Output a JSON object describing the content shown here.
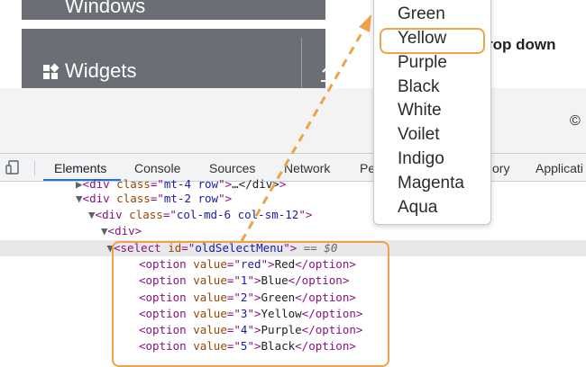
{
  "sidebar": {
    "items": [
      {
        "label": "Windows"
      },
      {
        "label": "Widgets"
      }
    ]
  },
  "page": {
    "heading_fragment": "rop down",
    "copyright_symbol": "©"
  },
  "devtools": {
    "tabs": [
      "Elements",
      "Console",
      "Sources",
      "Network",
      "Pe",
      "ory",
      "Applicati"
    ],
    "active_tab": "Elements"
  },
  "code": {
    "line0": {
      "tag": "div",
      "attr": "class",
      "value": "mt-4 row",
      "rest": "…</div>"
    },
    "line1": {
      "tag": "div",
      "attr": "class",
      "value": "mt-2 row"
    },
    "line2": {
      "tag": "div",
      "attr": "class",
      "value": "col-md-6 col-sm-12"
    },
    "line3": {
      "tag": "div"
    },
    "line4": {
      "tag": "select",
      "attr": "id",
      "value": "oldSelectMenu",
      "suffix": "== $0"
    },
    "options": [
      {
        "value": "red",
        "text": "Red"
      },
      {
        "value": "1",
        "text": "Blue"
      },
      {
        "value": "2",
        "text": "Green"
      },
      {
        "value": "3",
        "text": "Yellow"
      },
      {
        "value": "4",
        "text": "Purple"
      },
      {
        "value": "5",
        "text": "Black"
      }
    ]
  },
  "dropdown": {
    "options": [
      "Green",
      "Yellow",
      "Purple",
      "Black",
      "White",
      "Voilet",
      "Indigo",
      "Magenta",
      "Aqua"
    ],
    "highlighted": "Yellow"
  },
  "colors": {
    "accent_orange": "#f0a24a",
    "sidebar_bg": "#6b6f75",
    "devtools_active": "#1a73e8"
  }
}
